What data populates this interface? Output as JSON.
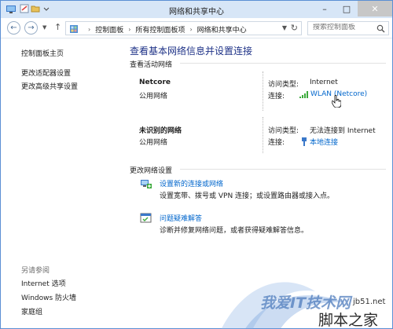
{
  "window": {
    "title": "网络和共享中心"
  },
  "address": {
    "crumbs": [
      "控制面板",
      "所有控制面板项",
      "网络和共享中心"
    ],
    "search_placeholder": "搜索控制面板"
  },
  "sidebar": {
    "links": [
      "控制面板主页",
      "更改适配器设置",
      "更改高级共享设置"
    ],
    "see_also_heading": "另请参阅",
    "see_also": [
      "Internet 选项",
      "Windows 防火墙",
      "家庭组"
    ]
  },
  "main": {
    "title": "查看基本网络信息并设置连接",
    "active_heading": "查看活动网络",
    "networks": [
      {
        "name": "Netcore",
        "type": "公用网络",
        "access_key": "访问类型:",
        "access_value": "Internet",
        "conn_key": "连接:",
        "conn_value": "WLAN (Netcore)",
        "conn_icon": "wifi-signal-icon"
      },
      {
        "name": "未识别的网络",
        "type": "公用网络",
        "access_key": "访问类型:",
        "access_value": "无法连接到 Internet",
        "conn_key": "连接:",
        "conn_value": "本地连接",
        "conn_icon": "ethernet-icon"
      }
    ],
    "change_heading": "更改网络设置",
    "tasks": [
      {
        "link": "设置新的连接或网络",
        "desc": "设置宽带、拨号或 VPN 连接；或设置路由器或接入点。",
        "icon": "new-connection-icon"
      },
      {
        "link": "问题疑难解答",
        "desc": "诊断并修复网络问题，或者获得疑难解答信息。",
        "icon": "troubleshoot-icon"
      }
    ]
  },
  "watermark": {
    "line1": "我爱IT技术网",
    "line2": "jb51.net",
    "line3": "脚本之家"
  }
}
